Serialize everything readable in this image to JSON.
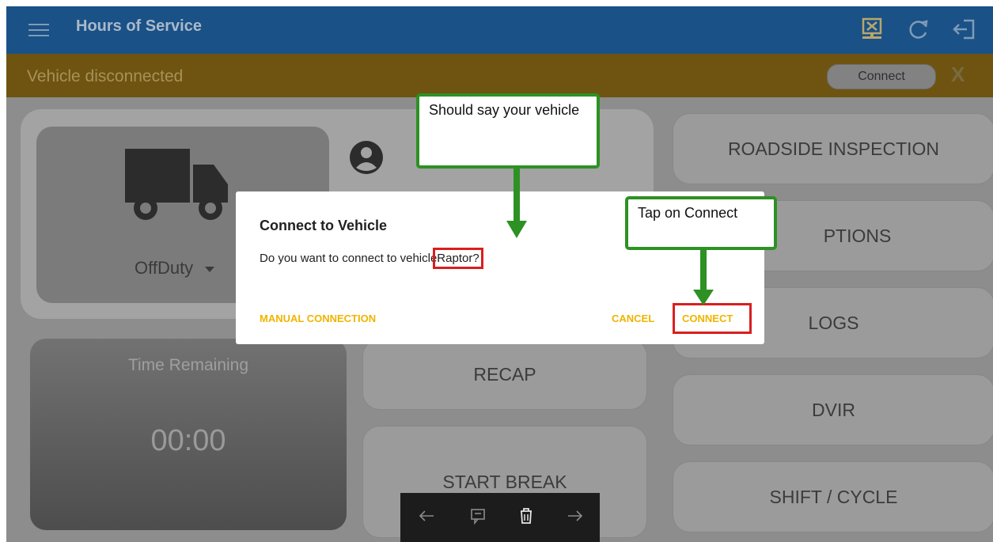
{
  "appbar": {
    "title": "Hours of Service",
    "icons": [
      "menu-icon",
      "disconnect-icon",
      "refresh-icon",
      "logout-icon"
    ]
  },
  "banner": {
    "message": "Vehicle disconnected",
    "connect_label": "Connect",
    "close_label": "X"
  },
  "driver_card": {
    "status": "OffDuty",
    "icons": [
      "truck-icon",
      "user-icon",
      "dropdown-icon"
    ]
  },
  "time_remaining": {
    "label": "Time Remaining",
    "value": "00:00"
  },
  "middle_buttons": [
    "RECAP",
    "START BREAK"
  ],
  "right_buttons": [
    "ROADSIDE INSPECTION",
    "PTIONS",
    "LOGS",
    "DVIR",
    "SHIFT / CYCLE"
  ],
  "dialog": {
    "title": "Connect to Vehicle",
    "message_prefix": "Do you want to connect to vehicle",
    "vehicle_name": "Raptor?",
    "manual_label": "MANUAL CONNECTION",
    "cancel_label": "CANCEL",
    "connect_label": "CONNECT"
  },
  "annotations": {
    "callout_vehicle": "Should say your vehicle",
    "callout_connect": "Tap on Connect"
  },
  "bottom_toolbar": {
    "icons": [
      "back-arrow-icon",
      "comment-icon",
      "trash-icon",
      "forward-arrow-icon"
    ]
  },
  "colors": {
    "appbar": "#1a5186",
    "banner": "#6e5410",
    "dialog_button": "#f0b400",
    "highlight_red": "#d81f1f",
    "callout_green": "#2d9123"
  }
}
